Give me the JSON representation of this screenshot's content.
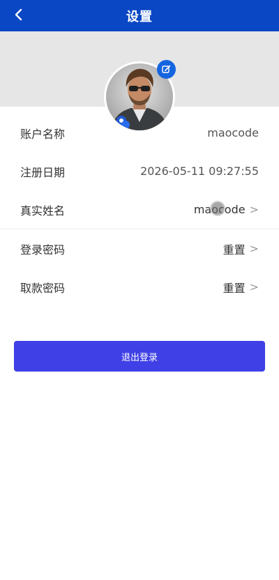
{
  "header": {
    "title": "设置",
    "back_icon": "chevron-left-icon",
    "background": "#0a47c4"
  },
  "profile": {
    "avatar_alt": "avatar",
    "edit_icon": "edit-icon",
    "edit_badge_color": "#1565e0"
  },
  "rows": [
    {
      "label": "账户名称",
      "value": "maocode"
    },
    {
      "label": "注册日期",
      "value": "2026-05-11 09:27:55"
    },
    {
      "label": "真实姓名",
      "value": "maocode",
      "chevron": ">"
    },
    {
      "label": "登录密码",
      "value": "重置",
      "chevron": ">"
    },
    {
      "label": "取款密码",
      "value": "重置",
      "chevron": ">"
    }
  ],
  "logout": {
    "label": "退出登录",
    "color": "#3f40e6"
  }
}
